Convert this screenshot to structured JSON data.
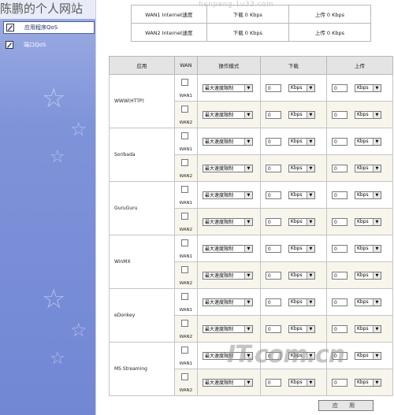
{
  "watermark": {
    "site_title": "陈鹏的个人网站",
    "url": "henpeng.1u33.com",
    "logo": "IT.com.cn"
  },
  "sidebar": {
    "items": [
      {
        "label": "应用程序QoS",
        "icon": "pencil-icon",
        "active": true
      },
      {
        "label": "端口QoS",
        "icon": "pencil-icon",
        "active": false
      }
    ]
  },
  "speed": {
    "rows": [
      {
        "label": "WAN1 Internet速度",
        "down": "下载 0 Kbps",
        "up": "上传 0 Kbps"
      },
      {
        "label": "WAN2 Internet速度",
        "down": "下载 0 Kbps",
        "up": "上传 0 Kbps"
      }
    ]
  },
  "qos": {
    "headers": {
      "app": "应用",
      "wan": "WAN",
      "mode": "操作模式",
      "down": "下载",
      "up": "上传"
    },
    "wan1": "WAN1",
    "wan2": "WAN2",
    "mode": "最大速度限制",
    "unit": "Kbps",
    "value": "0",
    "apps": [
      "WWW(HTTP)",
      "Soribada",
      "GuruGuru",
      "WinMX",
      "eDonkey",
      "MS Streaming"
    ]
  },
  "apply_label": "应 用"
}
